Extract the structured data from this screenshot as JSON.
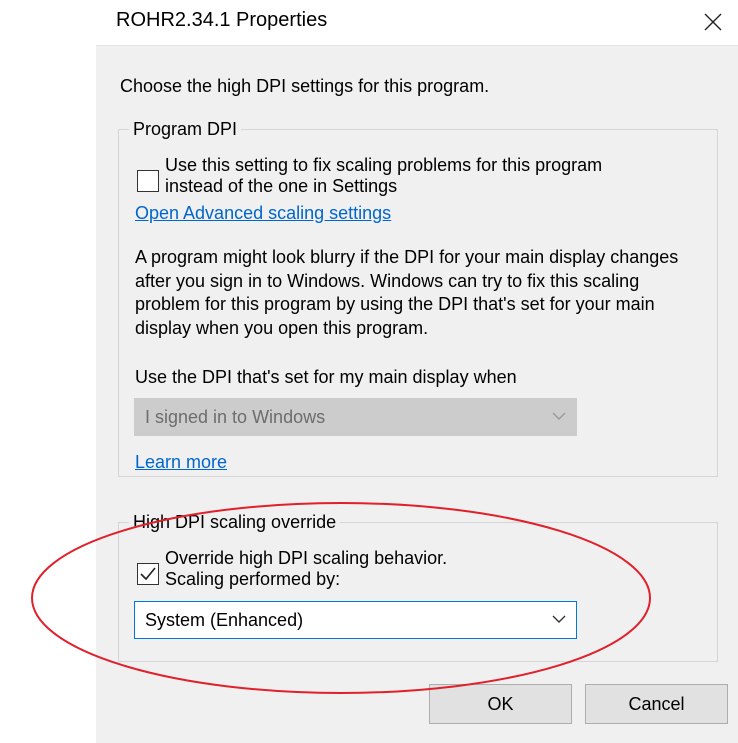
{
  "window": {
    "title": "ROHR2.34.1 Properties",
    "close_icon": "close-icon"
  },
  "intro": "Choose the high DPI settings for this program.",
  "program_dpi": {
    "group_label": "Program DPI",
    "checkbox_label_line1": "Use this setting to fix scaling problems for this program",
    "checkbox_label_line2": "instead of the one in Settings",
    "checked": false,
    "link": "Open Advanced scaling settings",
    "paragraph": "A program might look blurry if the DPI for your main display changes after you sign in to Windows. Windows can try to fix this scaling problem for this program by using the DPI that's set for your main display when you open this program.",
    "dropdown_label": "Use the DPI that's set for my main display when",
    "dropdown_value": "I signed in to Windows",
    "learn_more": "Learn more"
  },
  "override": {
    "group_label": "High DPI scaling override",
    "checkbox_label_line1": "Override high DPI scaling behavior.",
    "checkbox_label_line2": "Scaling performed by:",
    "checked": true,
    "dropdown_value": "System (Enhanced)"
  },
  "buttons": {
    "ok": "OK",
    "cancel": "Cancel"
  },
  "colors": {
    "dialog_background": "#f0f0f0",
    "link": "#0066cc",
    "focus_border": "#0078d7",
    "annotation_ellipse": "#e0202a"
  }
}
